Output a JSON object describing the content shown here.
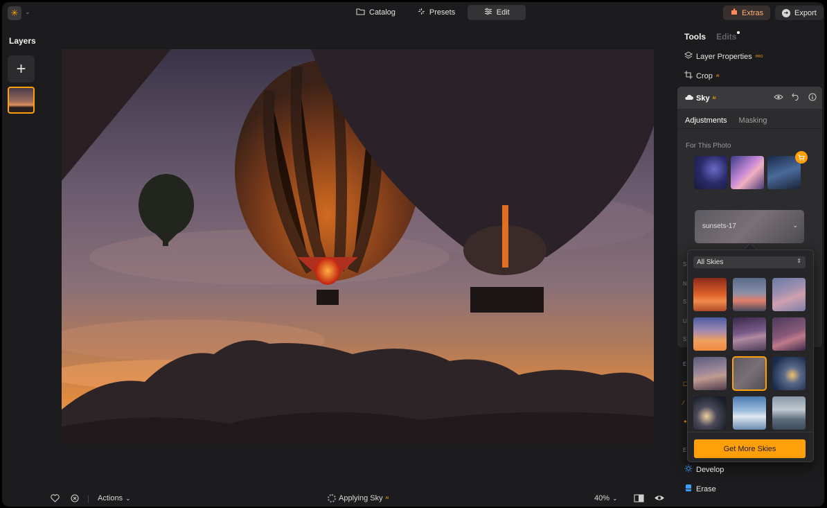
{
  "topbar": {
    "modes": [
      {
        "label": "Catalog",
        "icon": "folder-icon"
      },
      {
        "label": "Presets",
        "icon": "sparkle-icon"
      },
      {
        "label": "Edit",
        "icon": "sliders-icon"
      }
    ],
    "active_mode": "Edit",
    "extras_label": "Extras",
    "export_label": "Export"
  },
  "layers": {
    "title": "Layers"
  },
  "right_panel": {
    "tabs": {
      "tools": "Tools",
      "edits": "Edits"
    },
    "tools": [
      {
        "label": "Layer Properties",
        "badge": "PRO",
        "icon": "layers-icon"
      },
      {
        "label": "Crop",
        "badge": "AI",
        "icon": "crop-icon"
      }
    ],
    "sky": {
      "title": "Sky",
      "badge": "AI",
      "subtabs": [
        "Adjustments",
        "Masking"
      ],
      "for_this_photo_label": "For This Photo",
      "selected_sky": "sunsets-17"
    },
    "popover": {
      "filter_label": "All Skies",
      "get_more_label": "Get More Skies",
      "selected_index": 7
    },
    "lower_tools": [
      {
        "label": "Develop",
        "icon": "sun-icon"
      },
      {
        "label": "Erase",
        "icon": "eraser-icon"
      }
    ]
  },
  "bottombar": {
    "actions_label": "Actions",
    "status_label": "Applying Sky",
    "status_badge": "AI",
    "zoom": "40%"
  },
  "colors": {
    "accent": "#ff9f0a",
    "background": "#1c1c1e",
    "panel": "#2c2c2e"
  }
}
